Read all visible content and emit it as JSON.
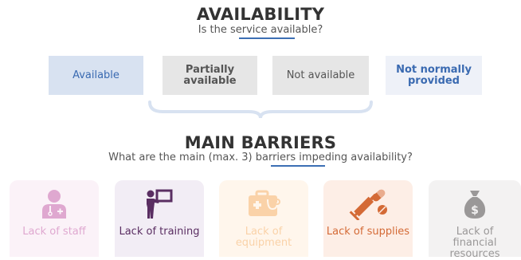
{
  "availability": {
    "title": "AVAILABILITY",
    "question": "Is the service available?",
    "options": [
      {
        "label": "Available"
      },
      {
        "label": "Partially available"
      },
      {
        "label": "Not available"
      },
      {
        "label": "Not normally provided"
      }
    ]
  },
  "barriers": {
    "title": "MAIN BARRIERS",
    "question": "What are the main (max. 3) barriers impeding availability?",
    "items": [
      {
        "label": "Lack of staff",
        "icon": "doctor-icon",
        "color": "#dfa8d0"
      },
      {
        "label": "Lack of training",
        "icon": "teacher-board-icon",
        "color": "#5a2e62"
      },
      {
        "label": "Lack of equipment",
        "icon": "medical-kit-icon",
        "color": "#fad2a8"
      },
      {
        "label": "Lack of supplies",
        "icon": "syringe-pills-icon",
        "color": "#d46a36"
      },
      {
        "label": "Lack of financial resources",
        "icon": "money-bag-icon",
        "color": "#9a9898"
      }
    ]
  },
  "colors": {
    "accent_blue": "#3c6fb4",
    "connector": "#d8e2f1"
  }
}
